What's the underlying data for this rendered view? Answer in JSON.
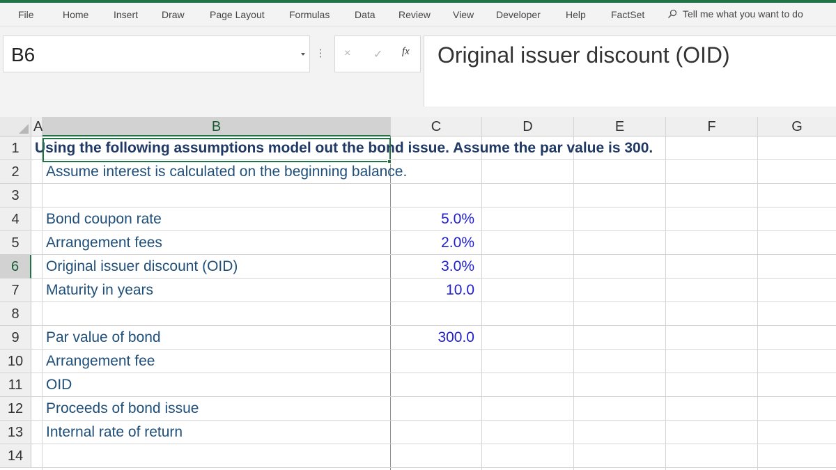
{
  "ribbon": {
    "tabs": [
      "File",
      "Home",
      "Insert",
      "Draw",
      "Page Layout",
      "Formulas",
      "Data",
      "Review",
      "View",
      "Developer",
      "Help",
      "FactSet"
    ],
    "tell_me": "Tell me what you want to do"
  },
  "formula_bar": {
    "name_box": "B6",
    "cancel_icon": "×",
    "enter_icon": "✓",
    "fx_label": "fx",
    "content": "Original issuer discount (OID)"
  },
  "sheet": {
    "columns": [
      "A",
      "B",
      "C",
      "D",
      "E",
      "F",
      "G"
    ],
    "selected_column": "B",
    "selected_row": "6",
    "rows": [
      "1",
      "2",
      "3",
      "4",
      "5",
      "6",
      "7",
      "8",
      "9",
      "10",
      "11",
      "12",
      "13",
      "14"
    ],
    "cells": {
      "r1": "Using the following assumptions model out the bond issue. Assume the par value is 300.",
      "r2": "Assume interest is calculated on the beginning balance.",
      "r4_label": "Bond coupon rate",
      "r4_value": "5.0%",
      "r5_label": "Arrangement fees",
      "r5_value": "2.0%",
      "r6_label": "Original issuer discount (OID)",
      "r6_value": "3.0%",
      "r7_label": "Maturity in years",
      "r7_value": "10.0",
      "r9_label": "Par value of bond",
      "r9_value": "300.0",
      "r10_label": "Arrangement fee",
      "r11_label": "OID",
      "r12_label": "Proceeds of bond issue",
      "r13_label": "Internal rate of return"
    }
  },
  "colors": {
    "accent": "#217346",
    "label_text": "#1f4e79",
    "value_text": "#1f1fd0",
    "title_text": "#1f3864"
  }
}
